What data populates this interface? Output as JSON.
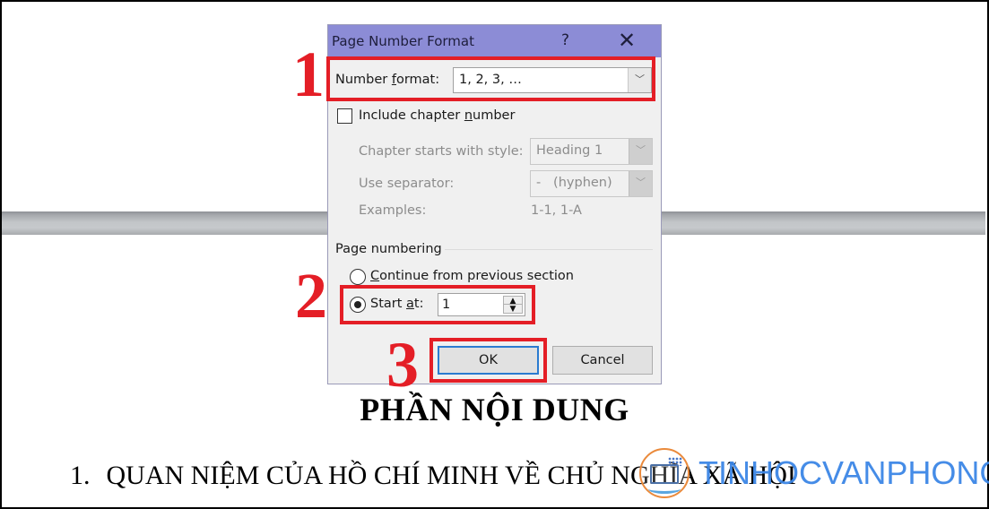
{
  "document": {
    "title": "PHẦN NỘI DUNG",
    "heading_number": "1.",
    "heading_text": "QUAN NIỆM CỦA HỒ CHÍ MINH VỀ CHỦ NGHĨA XÃ HỘI"
  },
  "watermark": {
    "text": "TINHOCVANPHONG",
    "icon": "monitor-logo-icon"
  },
  "dialog": {
    "title": "Page Number Format",
    "help_glyph": "?",
    "close_glyph": "✕",
    "number_format": {
      "label_pre": "Number ",
      "label_accel": "f",
      "label_post": "ormat:",
      "value": "1, 2, 3, …"
    },
    "include_chapter": {
      "label_pre": "Include chapter ",
      "label_accel": "n",
      "label_post": "umber",
      "checked": false
    },
    "chapter_style": {
      "label": "Chapter starts with style:",
      "value": "Heading 1"
    },
    "separator": {
      "label": "Use separator:",
      "value": "-   (hyphen)"
    },
    "examples": {
      "label": "Examples:",
      "value": "1-1, 1-A"
    },
    "page_numbering": {
      "group_label": "Page numbering",
      "continue": {
        "label_accel": "C",
        "label_post": "ontinue from previous section",
        "selected": false
      },
      "start_at": {
        "label_pre": "Start ",
        "label_accel": "a",
        "label_post": "t:",
        "selected": true,
        "value": "1"
      }
    },
    "ok_label": "OK",
    "cancel_label": "Cancel",
    "arrow_glyph": "﹀",
    "spin_up": "▲",
    "spin_down": "▼"
  },
  "annotations": {
    "step1": "1",
    "step2": "2",
    "step3": "3",
    "color": "#e41e26"
  }
}
